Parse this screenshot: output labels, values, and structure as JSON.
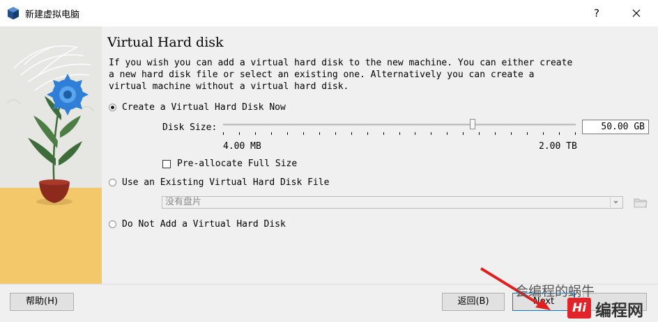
{
  "window": {
    "title": "新建虚拟电脑",
    "help_glyph": "?",
    "close_glyph": "✕"
  },
  "page": {
    "title": "Virtual Hard disk",
    "description": "If you wish you can add a virtual hard disk to the new machine. You can either create\na new hard disk file or select an existing one. Alternatively you can create a\nvirtual machine without a virtual hard disk."
  },
  "options": {
    "create_new": {
      "label": "Create a Virtual Hard Disk Now",
      "checked": true
    },
    "use_existing": {
      "label": "Use an Existing Virtual Hard Disk File",
      "checked": false
    },
    "no_disk": {
      "label": "Do Not Add a Virtual Hard Disk",
      "checked": false
    }
  },
  "disk_size": {
    "label": "Disk Size:",
    "value": "50.00 GB",
    "min_label": "4.00 MB",
    "max_label": "2.00 TB",
    "slider_fraction": 0.71
  },
  "preallocate": {
    "label": "Pre-allocate Full Size",
    "checked": false
  },
  "existing_file": {
    "selected": "没有盘片"
  },
  "buttons": {
    "help": "帮助(H)",
    "back": "返回(B)",
    "next": "Next"
  },
  "watermark": {
    "line1": "会编程的蜗牛",
    "line2": "编程网",
    "logo": "Hi"
  },
  "colors": {
    "sidebar_wall": "#e8e8e4",
    "sidebar_floor": "#f2c86a",
    "flower": "#2f7fd6",
    "leaf": "#3e6b3a",
    "pot": "#8c2a1e",
    "annotation_arrow": "#e01f1f"
  }
}
